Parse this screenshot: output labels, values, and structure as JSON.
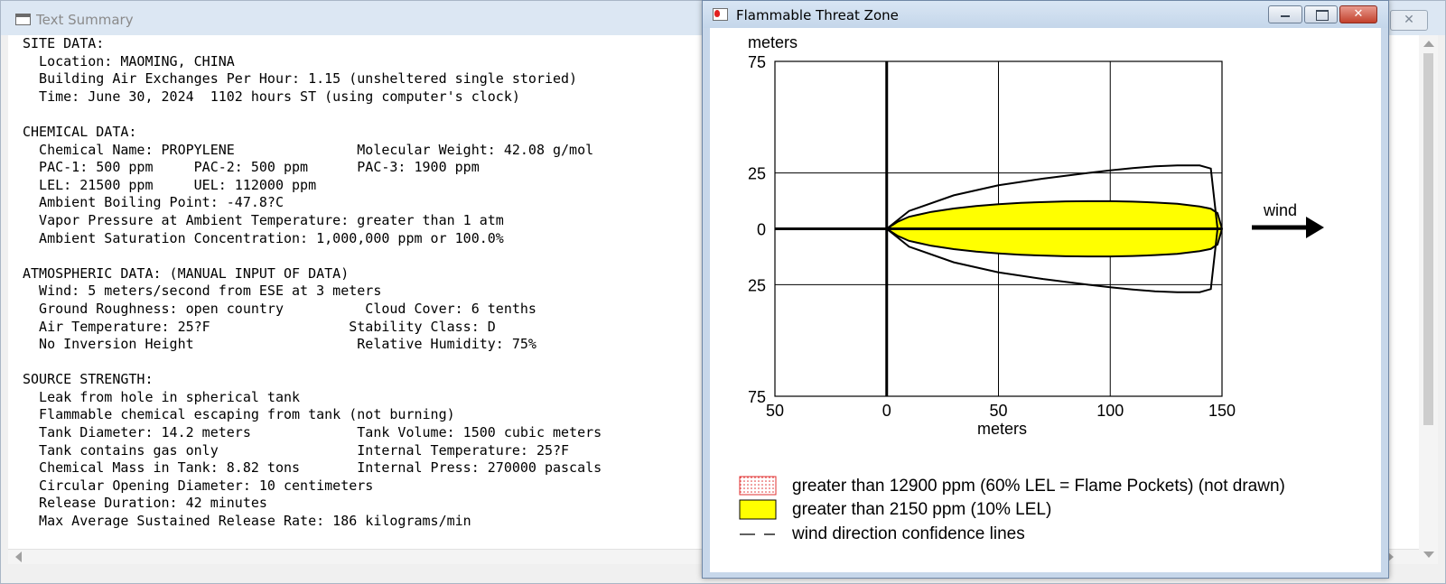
{
  "text_summary": {
    "title": "Text Summary",
    "close_label": "✕",
    "lines": [
      "SITE DATA:",
      "  Location: MAOMING, CHINA",
      "  Building Air Exchanges Per Hour: 1.15 (unsheltered single storied)",
      "  Time: June 30, 2024  1102 hours ST (using computer's clock)",
      "",
      "CHEMICAL DATA:",
      "  Chemical Name: PROPYLENE               Molecular Weight: 42.08 g/mol",
      "  PAC-1: 500 ppm     PAC-2: 500 ppm      PAC-3: 1900 ppm",
      "  LEL: 21500 ppm     UEL: 112000 ppm",
      "  Ambient Boiling Point: -47.8?C",
      "  Vapor Pressure at Ambient Temperature: greater than 1 atm",
      "  Ambient Saturation Concentration: 1,000,000 ppm or 100.0%",
      "",
      "ATMOSPHERIC DATA: (MANUAL INPUT OF DATA)",
      "  Wind: 5 meters/second from ESE at 3 meters",
      "  Ground Roughness: open country          Cloud Cover: 6 tenths",
      "  Air Temperature: 25?F                 Stability Class: D",
      "  No Inversion Height                    Relative Humidity: 75%",
      "",
      "SOURCE STRENGTH:",
      "  Leak from hole in spherical tank",
      "  Flammable chemical escaping from tank (not burning)",
      "  Tank Diameter: 14.2 meters             Tank Volume: 1500 cubic meters",
      "  Tank contains gas only                 Internal Temperature: 25?F",
      "  Chemical Mass in Tank: 8.82 tons       Internal Press: 270000 pascals",
      "  Circular Opening Diameter: 10 centimeters",
      "  Release Duration: 42 minutes",
      "  Max Average Sustained Release Rate: 186 kilograms/min"
    ]
  },
  "threat_zone": {
    "title": "Flammable Threat Zone",
    "wind_label": "wind",
    "legend": [
      {
        "label": "greater than 12900 ppm (60% LEL = Flame Pockets) (not drawn)",
        "swatch": "dotted-red"
      },
      {
        "label": "greater than 2150 ppm (10% LEL)",
        "swatch": "yellow"
      },
      {
        "label": "wind direction confidence lines",
        "swatch": "dashed-line"
      }
    ]
  },
  "colors": {
    "zone_fill": "#ffff00",
    "flame_pocket": "#e03030"
  },
  "chart_data": {
    "type": "area",
    "title": "",
    "xlabel": "meters",
    "ylabel": "meters",
    "xlim": [
      -50,
      150
    ],
    "ylim": [
      -75,
      75
    ],
    "x_ticks": [
      -50,
      0,
      50,
      100,
      150
    ],
    "x_tick_labels": [
      "50",
      "0",
      "50",
      "100",
      "150"
    ],
    "y_ticks": [
      75,
      25,
      0,
      -25,
      -75
    ],
    "y_tick_labels": [
      "75",
      "25",
      "0",
      "25",
      "75"
    ],
    "grid": true,
    "legend_position": "bottom",
    "threat_zone_half_width": {
      "x": [
        0,
        5,
        10,
        20,
        30,
        40,
        50,
        60,
        70,
        80,
        90,
        100,
        110,
        120,
        130,
        140,
        145,
        148,
        150
      ],
      "y": [
        0,
        3.2,
        5.4,
        7.6,
        9.1,
        10.2,
        11.0,
        11.6,
        12.0,
        12.3,
        12.4,
        12.4,
        12.2,
        11.8,
        11.2,
        10.0,
        9.0,
        7.0,
        0
      ]
    },
    "confidence_lines": {
      "x": [
        0,
        10,
        30,
        50,
        70,
        90,
        100,
        110,
        120,
        130,
        140,
        145,
        148
      ],
      "y": [
        0,
        8,
        15,
        19.5,
        22.5,
        25,
        26.2,
        27.2,
        28,
        28.4,
        28.4,
        27,
        0
      ]
    }
  }
}
